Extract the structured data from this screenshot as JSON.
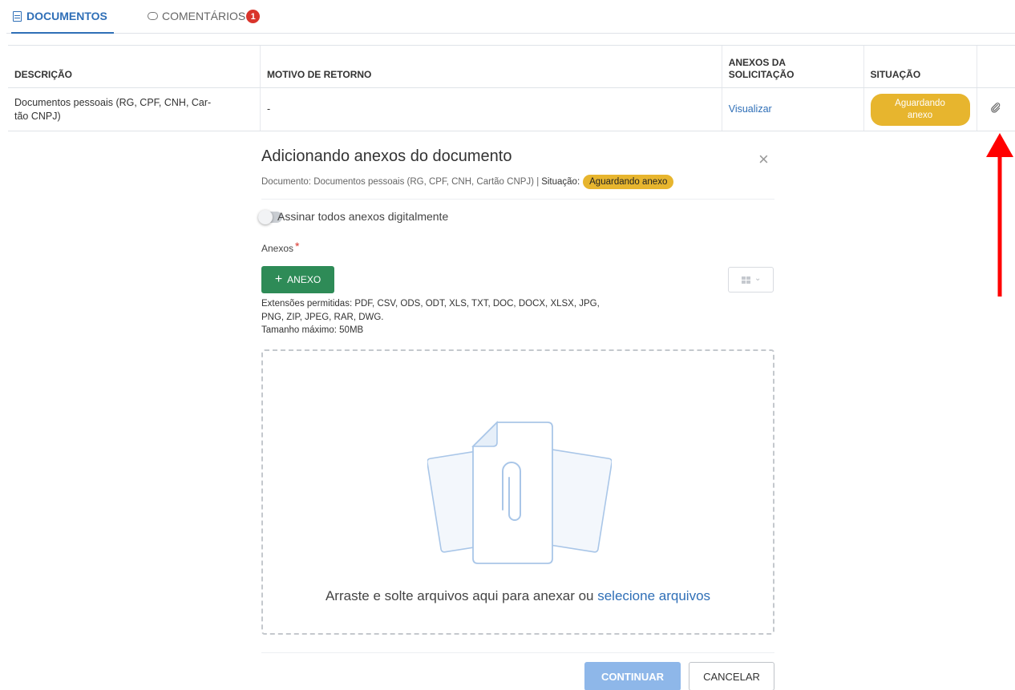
{
  "tabs": {
    "documents": "DOCUMENTOS",
    "comments": "COMENTÁRIOS",
    "comments_count": "1"
  },
  "table": {
    "headers": {
      "description": "DESCRIÇÃO",
      "return_reason": "MOTIVO DE RETORNO",
      "attachments_line1": "ANEXOS DA",
      "attachments_line2": "SOLICITAÇÃO",
      "status": "SITUAÇÃO"
    },
    "rows": [
      {
        "description_line1": "Documentos pessoais (RG, CPF, CNH, Car-",
        "description_line2": "tão CNPJ)",
        "return_reason": "-",
        "attachments_link": "Visualizar",
        "status_line1": "Aguardando",
        "status_line2": "anexo",
        "action_icon": "paperclip-icon"
      }
    ]
  },
  "modal": {
    "title": "Adicionando anexos do documento",
    "subtitle_document": "Documento: Documentos pessoais (RG, CPF, CNH, Cartão CNPJ) |",
    "subtitle_status_label": "Situação:",
    "subtitle_status_value": "Aguardando anexo",
    "toggle_label": "Assinar todos anexos digitalmente",
    "attachments_label": "Anexos",
    "required_mark": "*",
    "add_button": "ANEXO",
    "add_button_icon": "+",
    "extensions_line1": "Extensões permitidas: PDF, CSV, ODS, ODT, XLS, TXT, DOC, DOCX, XLSX, JPG,",
    "extensions_line2": "PNG, ZIP, JPEG, RAR, DWG.",
    "max_size": "Tamanho máximo: 50MB",
    "dropzone_text": "Arraste e solte arquivos aqui para anexar ou",
    "dropzone_link": "selecione arquivos",
    "continue_button": "CONTINUAR",
    "cancel_button": "CANCELAR",
    "close_glyph": "×"
  },
  "colors": {
    "accent_blue": "#2f6fb7",
    "status_yellow": "#e7b52e",
    "add_green": "#2e8b57",
    "continue_disabled": "#8eb7e9",
    "badge_red": "#d9342b",
    "annotation_arrow": "#ff0000"
  }
}
